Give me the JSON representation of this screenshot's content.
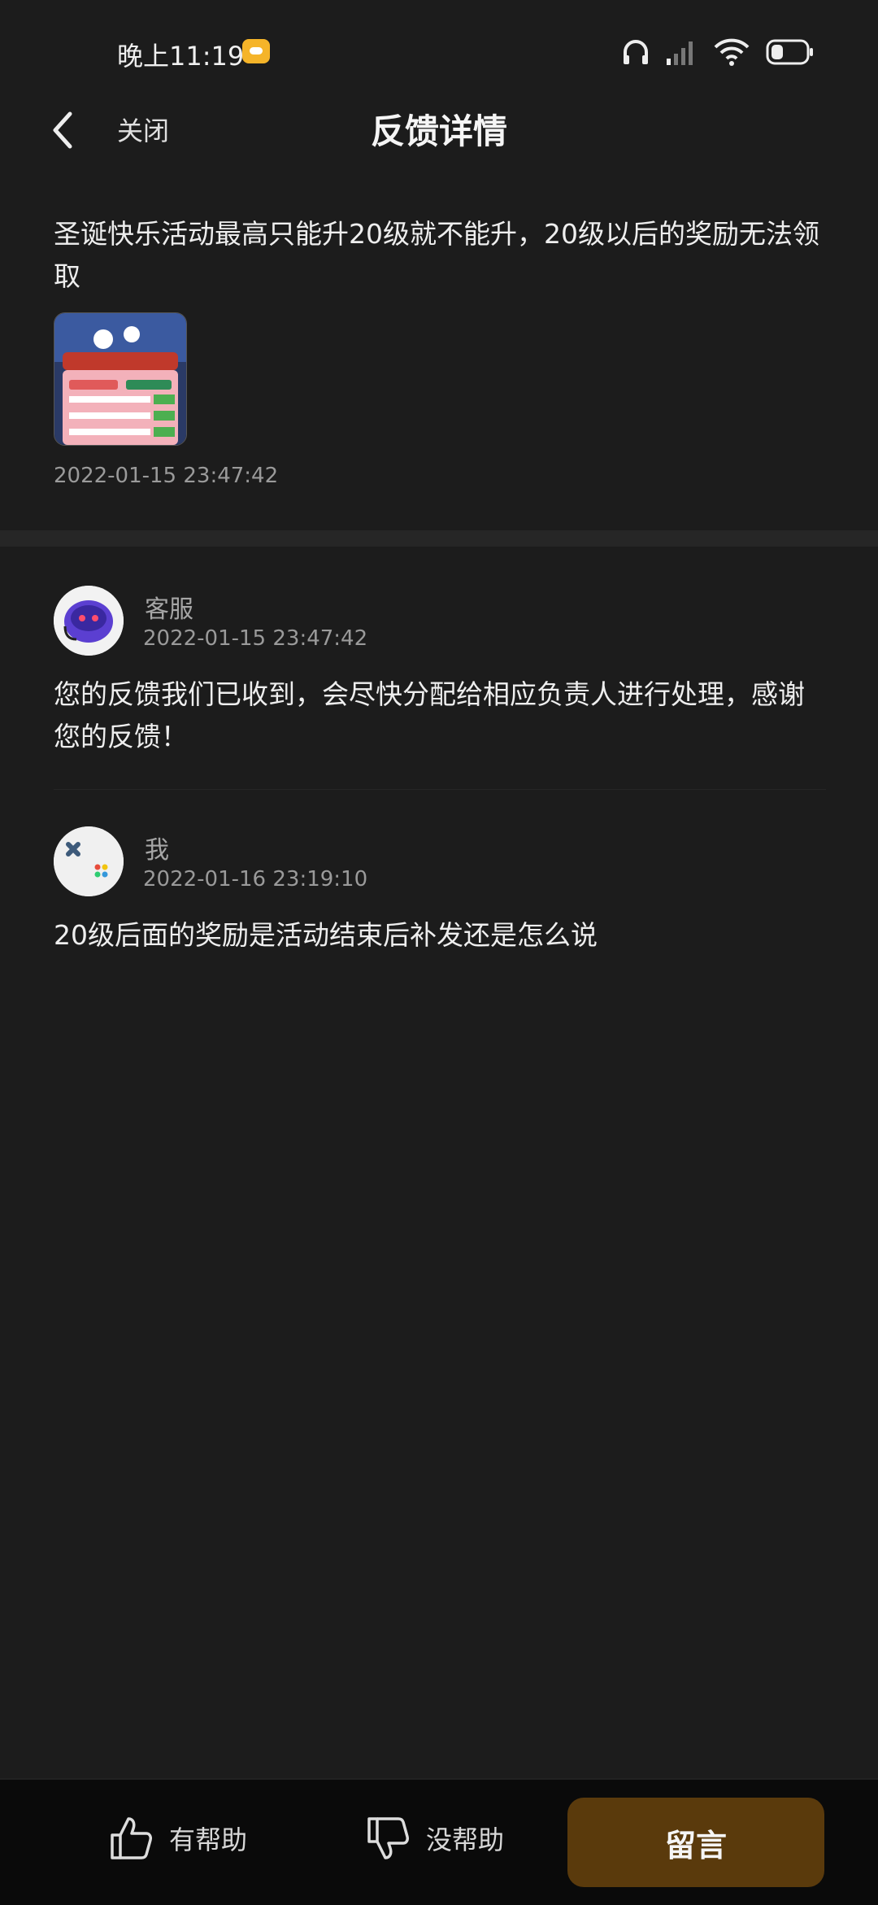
{
  "status_bar": {
    "time": "晚上11:19",
    "icons": [
      "chat-notification-icon",
      "headphones-icon",
      "signal-icon",
      "wifi-icon",
      "battery-icon"
    ]
  },
  "nav": {
    "back_icon": "chevron-left-icon",
    "close_label": "关闭",
    "title": "反馈详情"
  },
  "feedback": {
    "text": "圣诞快乐活动最高只能升20级就不能升，20级以后的奖励无法领取",
    "attachment": "screenshot-thumbnail",
    "time": "2022-01-15 23:47:42"
  },
  "messages": [
    {
      "sender": "客服",
      "time": "2022-01-15 23:47:42",
      "content": "您的反馈我们已收到，会尽快分配给相应负责人进行处理，感谢您的反馈！",
      "avatar": "robot-avatar-icon"
    },
    {
      "sender": "我",
      "time": "2022-01-16 23:19:10",
      "content": "20级后面的奖励是活动结束后补发还是怎么说",
      "avatar": "gamepad-avatar-icon"
    }
  ],
  "bottom": {
    "helpful_label": "有帮助",
    "unhelpful_label": "没帮助",
    "comment_label": "留言"
  },
  "colors": {
    "background": "#1c1c1c",
    "comment_button": "#5a3a0c",
    "bottom_bar": "#0a0a0a",
    "status_chat": "#f5b429"
  }
}
